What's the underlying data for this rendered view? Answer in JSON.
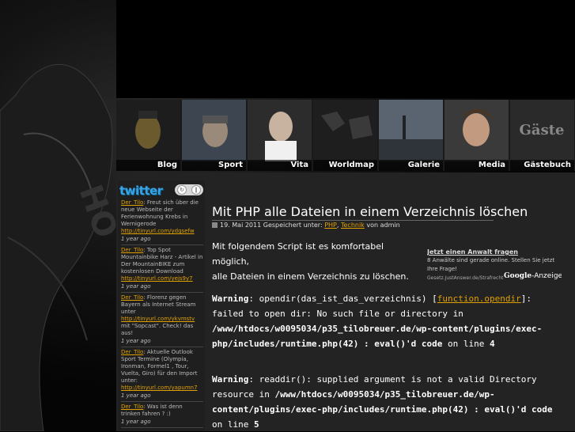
{
  "nav": {
    "items": [
      {
        "label": "Blog"
      },
      {
        "label": "Sport"
      },
      {
        "label": "Vita"
      },
      {
        "label": "Worldmap"
      },
      {
        "label": "Galerie"
      },
      {
        "label": "Media"
      },
      {
        "label": "Gästebuch"
      }
    ],
    "gaeste_thumb_text": "Gäste"
  },
  "twitter": {
    "logo": "twitter",
    "tweets": [
      {
        "user": "Der_Tilo",
        "text": ": Freut sich über die neue Webseite der Ferienwohnung Krebs in Wernigerode",
        "link": "http://tinyurl.com/ydgsefw",
        "ago": "1 year ago"
      },
      {
        "user": "Der_Tilo",
        "text": ": Top Spot Mountainbike Harz - Artikel in Der MountainBIKE zum kostenlosen Download",
        "link": "http://tinyurl.com/yejs9y7",
        "ago": "1 year ago"
      },
      {
        "user": "Der_Tilo",
        "text": ": Florenz gegen Bayern als Internet Stream unter",
        "link": "http://tinyurl.com/ykvmstv",
        "text2": "mit \"Sopcast\". Check! das aus!",
        "ago": "1 year ago"
      },
      {
        "user": "Der_Tilo",
        "text": ": Aktuelle Outlook Sport Termine (Olympia, Ironman, Formel1 , Tour, Vuelta, Giro) für den Import unter:",
        "link": "http://tinyurl.com/yapumn7",
        "ago": "1 year ago"
      },
      {
        "user": "Der_Tilo",
        "text": ": Was ist denn trinken fahren ? :)",
        "link": "",
        "ago": "1 year ago"
      }
    ]
  },
  "post": {
    "title": "Mit PHP alle Dateien in einem Verzeichnis löschen",
    "meta_date": "19. Mai 2011 Gespeichert unter:",
    "meta_cat1": "PHP",
    "meta_sep": ", ",
    "meta_cat2": "Technik",
    "meta_author": " von admin",
    "intro_line1": "Mit folgendem Script ist es komfortabel möglich,",
    "intro_line2": "alle Dateien in einem Verzeichnis zu löschen."
  },
  "ad": {
    "title": "Jetzt einen Anwalt fragen",
    "text": "8 Anwälte sind gerade online. Stellen Sie jetzt Ihre Frage!",
    "footer": "Gesetz.JustAnswer.de/Strafrecht",
    "google": "Google",
    "suffix": "-Anzeigen"
  },
  "warnings": [
    {
      "label": "Warning",
      "pre": ": opendir(das_ist_das_verzeichnis) [",
      "fn": "function.opendir",
      "post": "]: failed to open dir: No such file or directory in ",
      "path": "/www/htdocs/w0095034/p35_tilobreuer.de/wp-content/plugins/exec-php/includes/runtime.php(42) : eval()'d code",
      "online": " on line ",
      "line": "4"
    },
    {
      "label": "Warning",
      "pre": ": readdir(): supplied argument is not a valid Directory resource in ",
      "path": "/www/htdocs/w0095034/p35_tilobreuer.de/wp-content/plugins/exec-php/includes/runtime.php(42) : eval()'d code",
      "online": " on line ",
      "line": "5"
    }
  ]
}
